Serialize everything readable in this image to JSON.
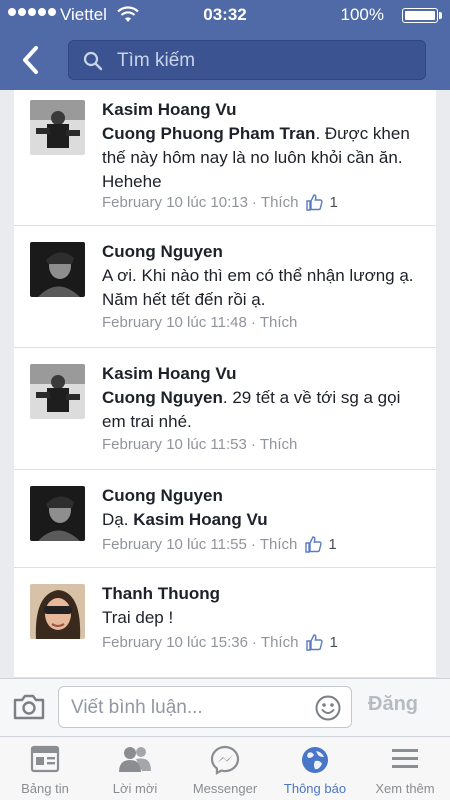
{
  "status_bar": {
    "carrier": "Viettel",
    "time": "03:32",
    "battery": "100%"
  },
  "header": {
    "search_placeholder": "Tìm kiếm"
  },
  "comments": [
    {
      "author": "Kasim Hoang Vu",
      "mention": "Cuong Phuong Pham Tran",
      "body": ". Được khen thế này hôm nay là no luôn khỏi cần ăn. Hehehe",
      "time": "February 10 lúc 10:13",
      "like_label": "Thích",
      "likes": "1"
    },
    {
      "author": "Cuong Nguyen",
      "mention": "",
      "body": "A ơi. Khi nào thì em có thể nhận lương ạ. Năm hết tết đến rồi ạ.",
      "time": "February 10 lúc 11:48",
      "like_label": "Thích",
      "likes": ""
    },
    {
      "author": "Kasim Hoang Vu",
      "mention": "Cuong Nguyen",
      "body": ". 29 tết a về tới sg a gọi em trai nhé.",
      "time": "February 10 lúc 11:53",
      "like_label": "Thích",
      "likes": ""
    },
    {
      "author": "Cuong Nguyen",
      "prefix": "Dạ. ",
      "mention": "Kasim Hoang Vu",
      "body": "",
      "time": "February 10 lúc 11:55",
      "like_label": "Thích",
      "likes": "1"
    },
    {
      "author": "Thanh Thuong",
      "mention": "",
      "body": "Trai dep !",
      "time": "February 10 lúc 15:36",
      "like_label": "Thích",
      "likes": "1"
    }
  ],
  "composer": {
    "placeholder": "Viết bình luận...",
    "post_label": "Đăng"
  },
  "tabs": [
    {
      "label": "Bảng tin",
      "icon": "news-feed-icon"
    },
    {
      "label": "Lời mời",
      "icon": "friend-requests-icon"
    },
    {
      "label": "Messenger",
      "icon": "messenger-icon"
    },
    {
      "label": "Thông báo",
      "icon": "globe-notifications-icon",
      "active": true
    },
    {
      "label": "Xem thêm",
      "icon": "menu-icon"
    }
  ],
  "colors": {
    "header": "#4f6aa6",
    "search_bg": "#3b5491",
    "active_tab": "#4a76c7",
    "meta_text": "#90949c"
  }
}
